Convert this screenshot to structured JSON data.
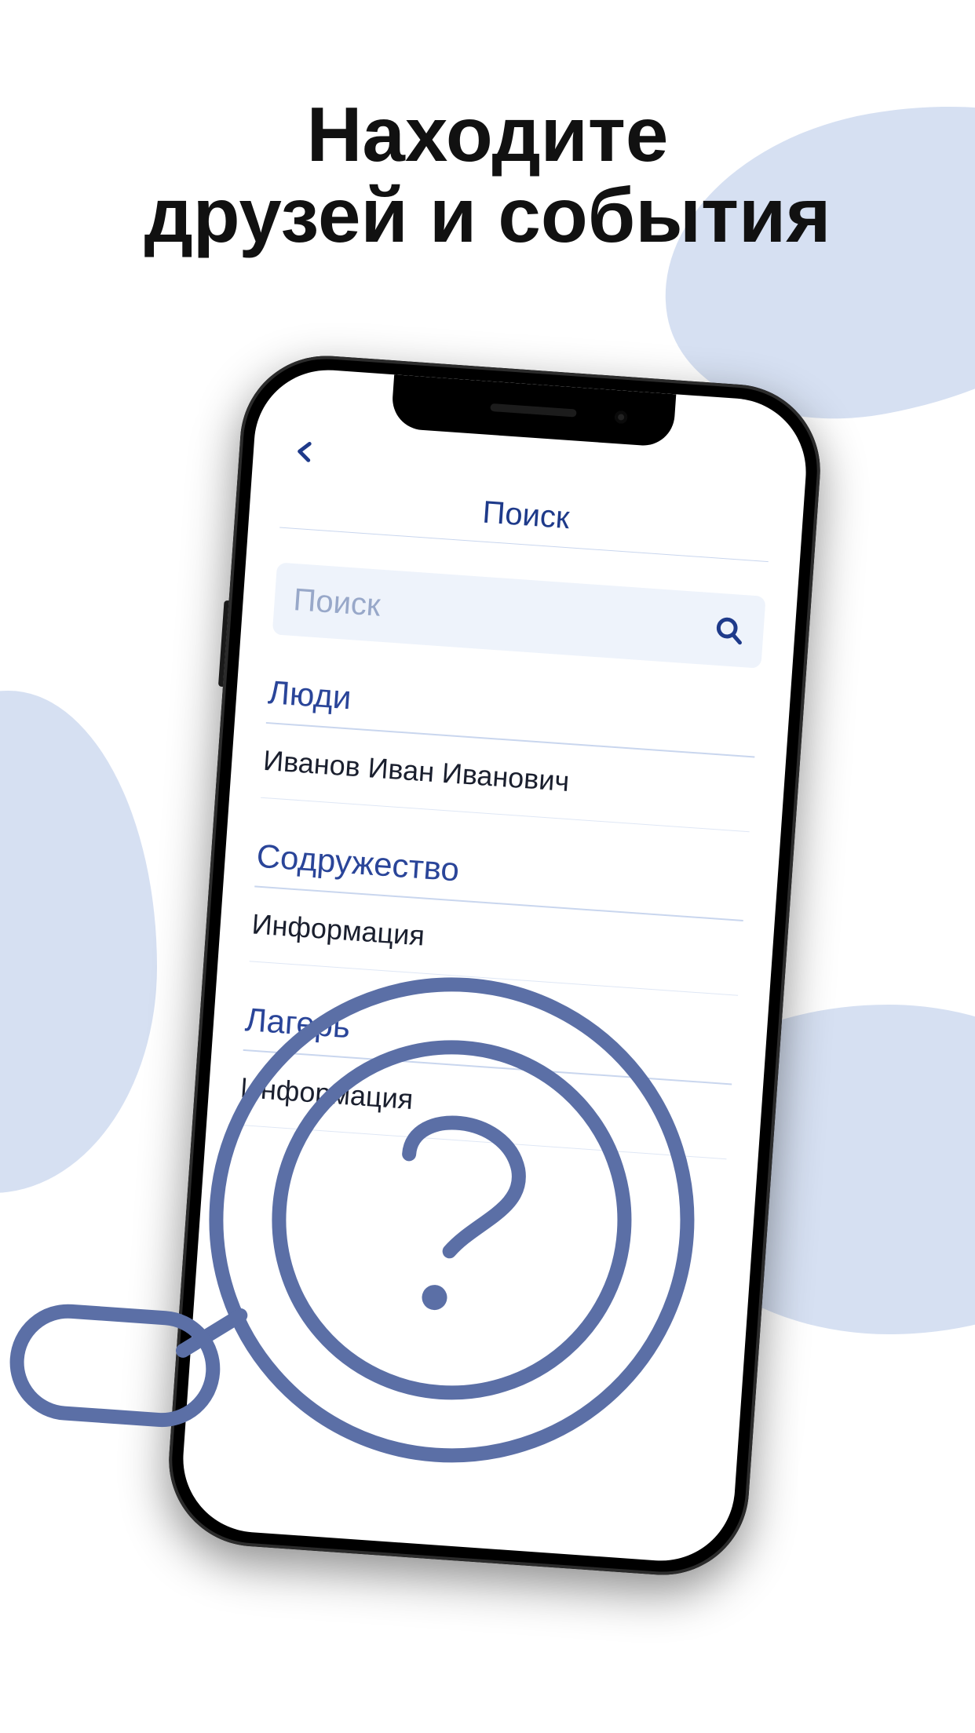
{
  "headline": {
    "line1": "Находите",
    "line2": "друзей и события"
  },
  "app": {
    "title": "Поиск",
    "search_placeholder": "Поиск",
    "sections": [
      {
        "title": "Люди",
        "rows": [
          "Иванов Иван Иванович"
        ]
      },
      {
        "title": "Содружество",
        "rows": [
          "Информация"
        ]
      },
      {
        "title": "Лагерь",
        "rows": [
          "Информация"
        ]
      }
    ]
  },
  "colors": {
    "accent": "#1e3a8a",
    "blob": "#d6e0f2",
    "magnifier": "#5b6fa6"
  }
}
